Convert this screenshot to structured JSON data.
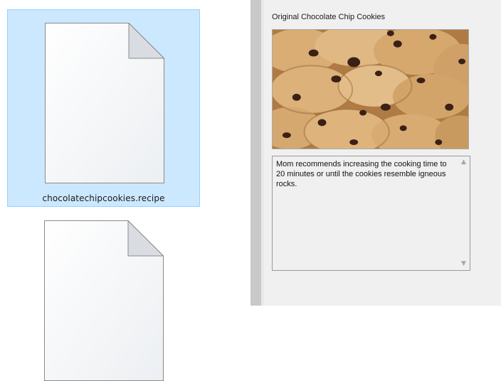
{
  "files": [
    {
      "name": "chocolatechipcookies.recipe",
      "selected": true,
      "icon": "document-icon"
    },
    {
      "name": "",
      "selected": false,
      "icon": "document-icon"
    }
  ],
  "preview": {
    "title": "Original Chocolate Chip Cookies",
    "image_icon": "cookies-photo",
    "notes": "Mom recommends increasing the cooking time to 20 minutes or until the cookies resemble igneous rocks."
  },
  "colors": {
    "selection_bg": "#cce8ff",
    "selection_border": "#99d1ff",
    "preview_bg": "#f0f0f0",
    "divider": "#c9c9c9"
  }
}
